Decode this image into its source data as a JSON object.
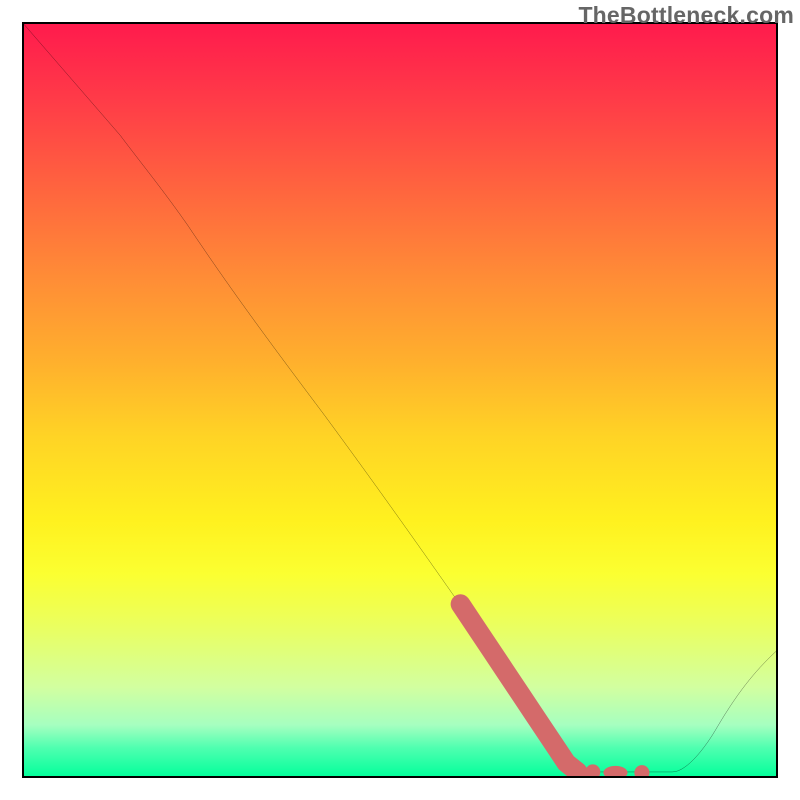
{
  "watermark": "TheBottleneck.com",
  "chart_data": {
    "type": "line",
    "title": "",
    "xlabel": "",
    "ylabel": "",
    "xlim": [
      0,
      100
    ],
    "ylim": [
      0,
      100
    ],
    "series": [
      {
        "name": "curve",
        "color": "#000000",
        "x": [
          0,
          13,
          22,
          30,
          40,
          50,
          60,
          66,
          70,
          74,
          80,
          86,
          90,
          95,
          100
        ],
        "y": [
          100,
          85,
          73,
          62,
          48,
          34,
          20,
          11,
          5,
          1,
          0,
          0,
          3,
          9,
          17
        ]
      }
    ],
    "highlight": {
      "name": "pink-segment",
      "color": "#d46a6a",
      "x": [
        58,
        60,
        62,
        64,
        66,
        68,
        70,
        72,
        73.5,
        76,
        78,
        80,
        82
      ],
      "y": [
        23,
        20,
        17,
        14,
        11,
        8,
        5,
        2,
        0.8,
        0.8,
        0.5,
        0.5,
        0.5
      ]
    },
    "background_gradient": {
      "top": "#ff1a4d",
      "mid": "#ffe81f",
      "bottom": "#00ff9a"
    }
  },
  "colors": {
    "curve": "#000000",
    "highlight": "#d46a6a",
    "axes": "#000000",
    "watermark": "#666666"
  }
}
